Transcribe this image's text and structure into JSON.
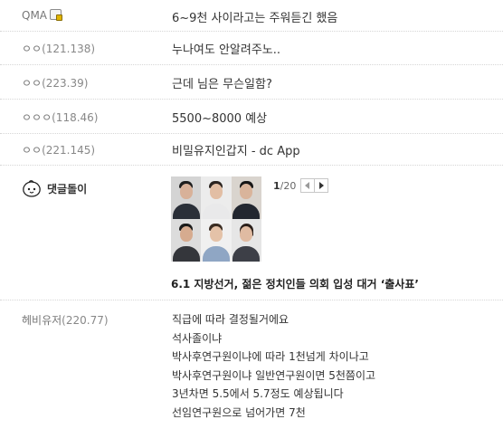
{
  "comments": [
    {
      "nick": "QMA",
      "ip": "",
      "text": "6~9천 사이라고는 주워듣긴 했음"
    },
    {
      "nick": "ㅇㅇ",
      "ip": "(121.138)",
      "text": "누나여도 안알려주노.."
    },
    {
      "nick": "ㅇㅇ",
      "ip": "(223.39)",
      "text": "근데 님은 무슨일함?"
    },
    {
      "nick": "ㅇㅇㅇ",
      "ip": "(118.46)",
      "text": "5500~8000 예상"
    },
    {
      "nick": "ㅇㅇ",
      "ip": "(221.145)",
      "text": "비밀유지인갑지 - dc App"
    }
  ],
  "bot": {
    "name": "댓글돌이",
    "pager_current": "1",
    "pager_total": "/20",
    "news_title": "6.1 지방선거, 젊은 정치인들 의회 입성 대거 ‘출사표’"
  },
  "last_comment": {
    "nick": "헤비유저",
    "ip": "(220.77)",
    "lines": [
      "직급에 따라 결정될거에요",
      "석사졸이냐",
      "박사후연구원이냐에 따라 1천넘게 차이나고",
      "박사후연구원이냐 일반연구원이면 5천쯤이고",
      "3년차면 5.5에서 5.7정도 예상됩니다",
      "선임연구원으로 넘어가면 7천"
    ]
  },
  "colors": {
    "text": "#333333",
    "nick": "#777777",
    "divider": "#d6d6d6"
  }
}
